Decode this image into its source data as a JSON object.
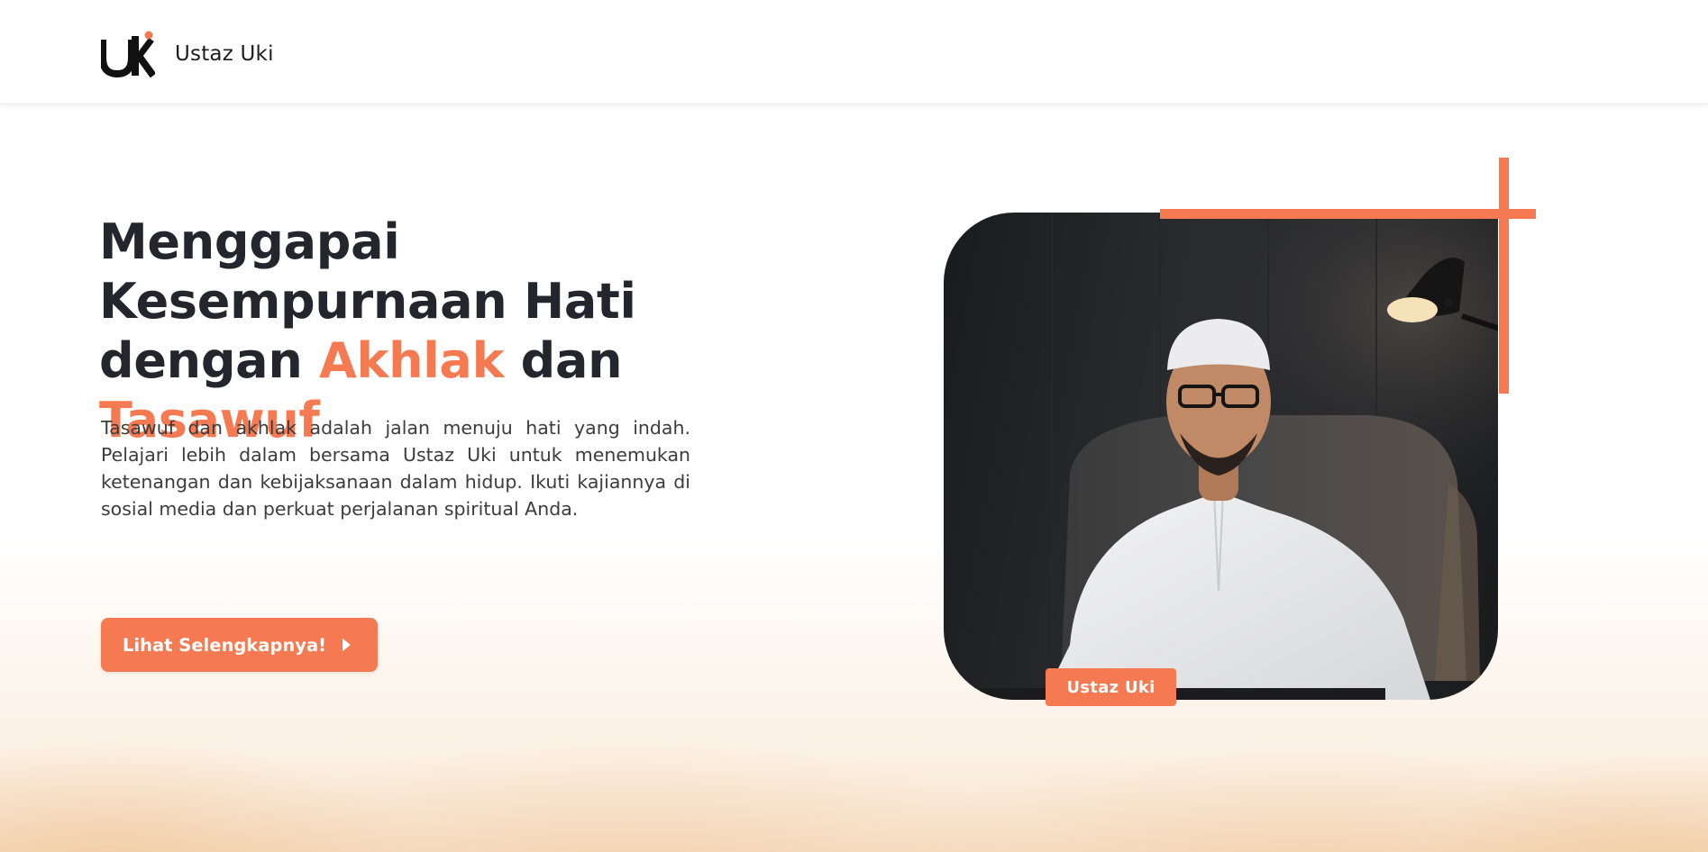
{
  "header": {
    "brand_name": "Ustaz Uki",
    "logo_icon": "uk-monogram-logo"
  },
  "hero": {
    "title_part1": "Menggapai Kesempurnaan Hati dengan ",
    "title_accent1": "Akhlak",
    "title_part2": " dan ",
    "title_accent2": "Tasawuf",
    "description": "Tasawuf dan akhlak adalah jalan menuju hati yang indah. Pelajari lebih dalam bersama Ustaz Uki untuk menemukan ketenangan dan kebijaksanaan dalam hidup. Ikuti kajiannya di sosial media dan perkuat perjalanan spiritual Anda.",
    "cta_label": "Lihat Selengkapnya!",
    "cta_icon": "caret-right-icon"
  },
  "portrait": {
    "tag_label": "Ustaz Uki"
  },
  "colors": {
    "accent": "#f57a51",
    "heading": "#23262d",
    "body_text": "#3c3c3c"
  }
}
